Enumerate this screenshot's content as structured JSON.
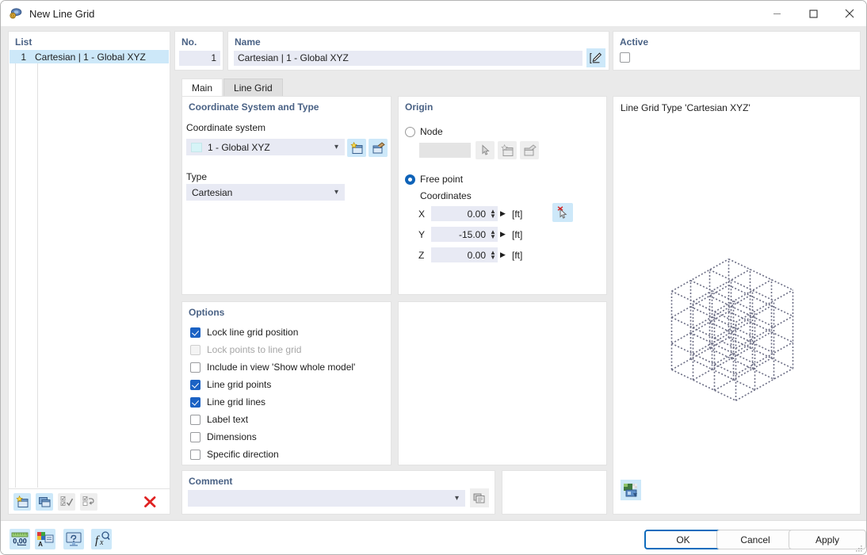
{
  "window": {
    "title": "New Line Grid",
    "icon": "line-grid-icon",
    "minimize": "—",
    "maximize": "☐",
    "close": "✕"
  },
  "list": {
    "title": "List",
    "rows": [
      {
        "no": "1",
        "label": "Cartesian | 1 - Global XYZ",
        "selected": true
      }
    ],
    "toolbar": [
      {
        "name": "new-item-button",
        "icon": "new-window-icon",
        "enabled": true
      },
      {
        "name": "copy-item-button",
        "icon": "copy-window-icon",
        "enabled": true
      },
      {
        "name": "select-all-button",
        "icon": "check-all-icon",
        "enabled": false
      },
      {
        "name": "deselect-all-button",
        "icon": "uncheck-all-icon",
        "enabled": false
      },
      {
        "name": "delete-item-button",
        "icon": "red-x-icon",
        "enabled": true
      }
    ]
  },
  "header": {
    "no_label": "No.",
    "no_value": "1",
    "name_label": "Name",
    "name_value": "Cartesian | 1 - Global XYZ",
    "name_edit_icon": "edit-pencil-icon",
    "active_label": "Active",
    "active_checked": false
  },
  "tabs": [
    {
      "label": "Main",
      "active": true
    },
    {
      "label": "Line Grid",
      "active": false
    }
  ],
  "coordinate_system": {
    "title": "Coordinate System and Type",
    "cs_label": "Coordinate system",
    "cs_value": "1 - Global XYZ",
    "cs_swatch": "#d6f4f7",
    "cs_new_icon": "new-coordinate-system-icon",
    "cs_edit_icon": "edit-coordinate-system-icon",
    "type_label": "Type",
    "type_value": "Cartesian"
  },
  "origin": {
    "title": "Origin",
    "node_label": "Node",
    "node_selected": false,
    "node_value": "",
    "node_pick_icon": "pick-cursor-icon",
    "node_new_icon": "new-node-icon",
    "node_edit_icon": "edit-node-icon",
    "free_point_label": "Free point",
    "free_point_selected": true,
    "coordinates_label": "Coordinates",
    "coords": [
      {
        "axis": "X",
        "value": "0.00",
        "unit": "[ft]"
      },
      {
        "axis": "Y",
        "value": "-15.00",
        "unit": "[ft]"
      },
      {
        "axis": "Z",
        "value": "0.00",
        "unit": "[ft]"
      }
    ],
    "pick_point_icon": "pick-point-cursor-icon"
  },
  "options": {
    "title": "Options",
    "items": [
      {
        "label": "Lock line grid position",
        "checked": true,
        "enabled": true
      },
      {
        "label": "Lock points to line grid",
        "checked": false,
        "enabled": false
      },
      {
        "label": "Include in view 'Show whole model'",
        "checked": false,
        "enabled": true
      },
      {
        "label": "Line grid points",
        "checked": true,
        "enabled": true
      },
      {
        "label": "Line grid lines",
        "checked": true,
        "enabled": true
      },
      {
        "label": "Label text",
        "checked": false,
        "enabled": true
      },
      {
        "label": "Dimensions",
        "checked": false,
        "enabled": true
      },
      {
        "label": "Specific direction",
        "checked": false,
        "enabled": true
      }
    ]
  },
  "comment": {
    "title": "Comment",
    "value": "",
    "dropdown_icon": "chevron-down-icon",
    "button_icon": "comment-list-icon"
  },
  "preview": {
    "title": "Line Grid Type 'Cartesian XYZ'",
    "settings_icon": "render-settings-icon",
    "grid": {
      "nx": 3,
      "ny": 3,
      "nz": 3,
      "style": "dotted",
      "color": "#6b6d84"
    }
  },
  "bottom_bar": {
    "icons": [
      {
        "name": "units-button",
        "icon": "units-0-00-icon"
      },
      {
        "name": "text-format-button",
        "icon": "text-format-icon"
      },
      {
        "name": "help-display-button",
        "icon": "monitor-help-icon"
      },
      {
        "name": "function-button",
        "icon": "fx-icon"
      }
    ],
    "ok": "OK",
    "cancel": "Cancel",
    "apply": "Apply"
  }
}
